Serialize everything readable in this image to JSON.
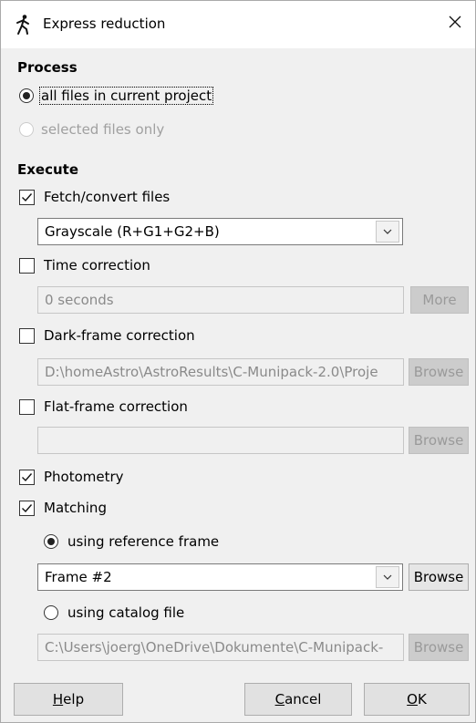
{
  "window": {
    "title": "Express reduction",
    "icon": "running-figure-icon",
    "close_icon": "close-icon"
  },
  "process": {
    "heading": "Process",
    "options": [
      {
        "label": "all files in current project",
        "selected": true,
        "enabled": true
      },
      {
        "label": "selected files only",
        "selected": false,
        "enabled": false
      }
    ]
  },
  "execute": {
    "heading": "Execute",
    "fetch": {
      "label": "Fetch/convert files",
      "checked": true,
      "combo_value": "Grayscale (R+G1+G2+B)"
    },
    "time": {
      "label": "Time correction",
      "checked": false,
      "field_value": "0 seconds",
      "button": "More"
    },
    "dark": {
      "label": "Dark-frame correction",
      "checked": false,
      "field_value": "D:\\homeAstro\\AstroResults\\C-Munipack-2.0\\Proje",
      "button": "Browse"
    },
    "flat": {
      "label": "Flat-frame correction",
      "checked": false,
      "field_value": "",
      "button": "Browse"
    },
    "photometry": {
      "label": "Photometry",
      "checked": true
    },
    "matching": {
      "label": "Matching",
      "checked": true,
      "ref": {
        "label": "using reference frame",
        "selected": true,
        "combo_value": "Frame #2",
        "button": "Browse"
      },
      "catalog": {
        "label": "using catalog file",
        "selected": false,
        "field_value": "C:\\Users\\joerg\\OneDrive\\Dokumente\\C-Munipack-",
        "button": "Browse"
      }
    }
  },
  "buttons": {
    "help": {
      "accel": "H",
      "rest": "elp"
    },
    "cancel": {
      "accel": "C",
      "rest": "ancel"
    },
    "ok": {
      "accel": "O",
      "rest": "K"
    }
  }
}
